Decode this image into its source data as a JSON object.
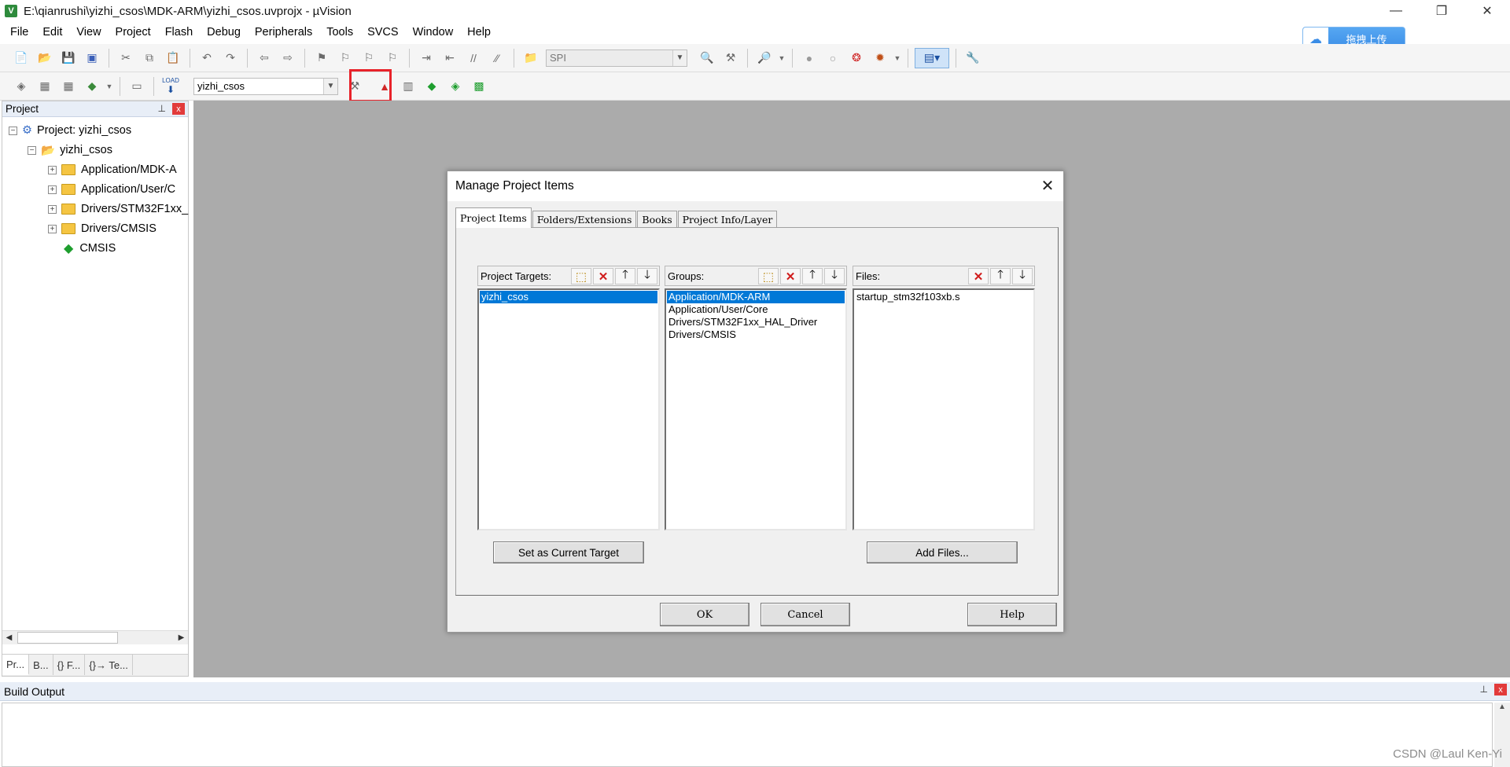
{
  "window": {
    "title": "E:\\qianrushi\\yizhi_csos\\MDK-ARM\\yizhi_csos.uvprojx - µVision",
    "app_icon_letter": "V",
    "minimize_glyph": "—",
    "restore_glyph": "❐",
    "close_glyph": "✕"
  },
  "menu": [
    "File",
    "Edit",
    "View",
    "Project",
    "Flash",
    "Debug",
    "Peripherals",
    "Tools",
    "SVCS",
    "Window",
    "Help"
  ],
  "cloud_upload": {
    "label": "拖拽上传",
    "icon": "cloud-icon"
  },
  "toolbar1": {
    "search_combo_value": "SPI",
    "icons": [
      "new-file-icon",
      "open-file-icon",
      "save-icon",
      "save-all-icon",
      "cut-icon",
      "copy-icon",
      "paste-icon",
      "undo-icon",
      "redo-icon",
      "nav-back-icon",
      "nav-forward-icon",
      "bookmark-icon",
      "bookmark-prev-icon",
      "bookmark-next-icon",
      "bookmark-clear-icon",
      "indent-icon",
      "unindent-icon",
      "comment-icon",
      "uncomment-icon",
      "find-in-files-icon",
      "find-icon",
      "incremental-find-icon",
      "debug-icon",
      "breakpoint-icon",
      "breakpoint-disable-icon",
      "breakpoint-clear-icon",
      "breakpoint-kill-icon",
      "window-layout-icon",
      "configure-icon"
    ]
  },
  "toolbar2": {
    "target_combo_value": "yizhi_csos",
    "icons": [
      "translate-icon",
      "build-icon",
      "rebuild-icon",
      "batch-build-icon",
      "stop-build-icon",
      "download-icon",
      "target-options-icon",
      "manage-project-items-icon",
      "file-extensions-icon",
      "manage-run-time-environment-icon",
      "select-software-packs-icon",
      "pack-installer-icon"
    ],
    "load_label": "LOAD"
  },
  "project_panel": {
    "title": "Project",
    "pin_glyph": "📌",
    "close_glyph": "x",
    "tree": [
      {
        "label": "Project: yizhi_csos",
        "expander": "−"
      },
      {
        "label": "yizhi_csos",
        "expander": "−"
      },
      {
        "label": "Application/MDK-A",
        "expander": "+"
      },
      {
        "label": "Application/User/C",
        "expander": "+"
      },
      {
        "label": "Drivers/STM32F1xx_",
        "expander": "+"
      },
      {
        "label": "Drivers/CMSIS",
        "expander": "+"
      },
      {
        "label": "CMSIS",
        "expander": ""
      }
    ],
    "tabs": [
      "Pr...",
      "B...",
      "{} F...",
      "{}→ Te..."
    ]
  },
  "build_output": {
    "title": "Build Output"
  },
  "watermark": "CSDN @Laul Ken-Yi",
  "dialog": {
    "title": "Manage Project Items",
    "close_glyph": "✕",
    "tabs": [
      "Project Items",
      "Folders/Extensions",
      "Books",
      "Project Info/Layer"
    ],
    "targets": {
      "header": "Project Targets:",
      "items": [
        "yizhi_csos"
      ],
      "selected": 0,
      "button": "Set as Current Target"
    },
    "groups": {
      "header": "Groups:",
      "items": [
        "Application/MDK-ARM",
        "Application/User/Core",
        "Drivers/STM32F1xx_HAL_Driver",
        "Drivers/CMSIS"
      ],
      "selected": 0
    },
    "files": {
      "header": "Files:",
      "items": [
        "startup_stm32f103xb.s"
      ],
      "selected": -1,
      "button": "Add Files..."
    },
    "list_buttons": {
      "new": "⬚",
      "delete": "✕",
      "up": "🡑",
      "down": "🡓"
    },
    "ok": "OK",
    "cancel": "Cancel",
    "help": "Help"
  }
}
